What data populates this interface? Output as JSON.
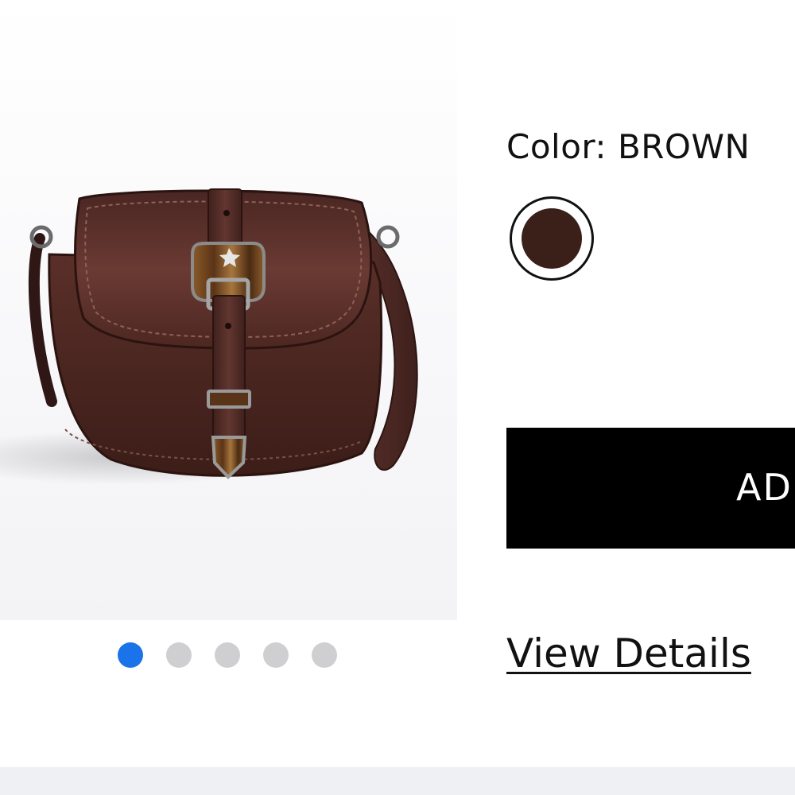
{
  "product": {
    "color_label": "Color:",
    "color_value": "BROWN",
    "swatch_color": "#3b1f19"
  },
  "gallery": {
    "image_count": 5,
    "active_index": 0,
    "active_dot_color": "#1a73e8",
    "inactive_dot_color": "#cfcfd1"
  },
  "actions": {
    "add_to_bag_label": "ADD",
    "view_details_label": "View Details"
  }
}
